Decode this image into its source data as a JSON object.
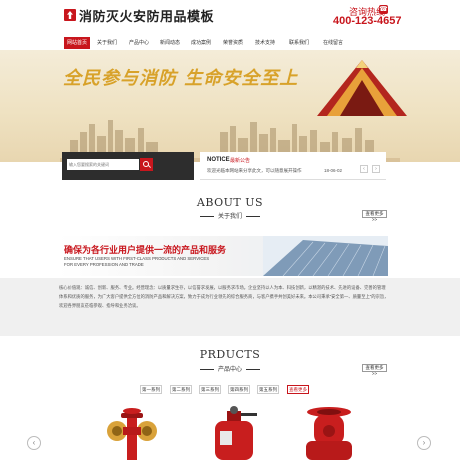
{
  "header": {
    "site_title": "消防灭火安防用品模板",
    "hotline_label": "咨询热线",
    "hotline_number": "400-123-4657"
  },
  "nav": {
    "items": [
      {
        "label": "网站首页",
        "active": true
      },
      {
        "label": "关于我们",
        "active": false
      },
      {
        "label": "产品中心",
        "active": false
      },
      {
        "label": "新闻动态",
        "active": false
      },
      {
        "label": "成功案例",
        "active": false
      },
      {
        "label": "荣誉资质",
        "active": false
      },
      {
        "label": "技术支持",
        "active": false
      },
      {
        "label": "联系我们",
        "active": false
      },
      {
        "label": "在线留言",
        "active": false
      }
    ]
  },
  "banner": {
    "slogan": "全民参与消防  生命安全至上"
  },
  "search": {
    "placeholder": "输入您要搜索的关键词"
  },
  "notice": {
    "title": "NOTICE",
    "subtitle": "最新公告",
    "text": "欢迎光临本网站来分享此文，可以随意展开操作",
    "date": "18-06-02",
    "prev": "‹",
    "next": "›"
  },
  "about": {
    "title": "ABOUT US",
    "subtitle": "关于我们",
    "more": "查看更多>>",
    "headline": "确保为各行业用户提供一流的产品和服务",
    "en_text": "ENSURE THAT USERS WITH FIRST-CLASS PRODUCTS AND SERVICES FOR EVERY PROFESSION AND TRADE",
    "body": "核心价值观：诚信、创新、服务、专业。经营理念：以质量求生存，以信誉求发展，以服务求市场。企业坚持以人为本、科技创新，以精湛的技术、先进的设备、完善的管理体系和优质的服务，为广大客户提供全方位的消防产品和解决方案，致力于成为行业领先的综合服务商，与客户携手共创美好未来。本公司秉承“安全第一、质量至上”的宗旨，欢迎各界朋友莅临参观、指导和业务洽谈。"
  },
  "products": {
    "title": "PRDUCTS",
    "subtitle": "产品中心",
    "more": "查看更多>>",
    "tabs": [
      "第一系列",
      "第二系列",
      "第三系列",
      "第四系列",
      "第五系列",
      "查看更多"
    ],
    "prev": "‹",
    "next": "›"
  },
  "colors": {
    "accent": "#c8161d",
    "gold": "#d8a22a",
    "dark_panel": "#2d2d2d",
    "light_bg": "#f0f0f0"
  }
}
